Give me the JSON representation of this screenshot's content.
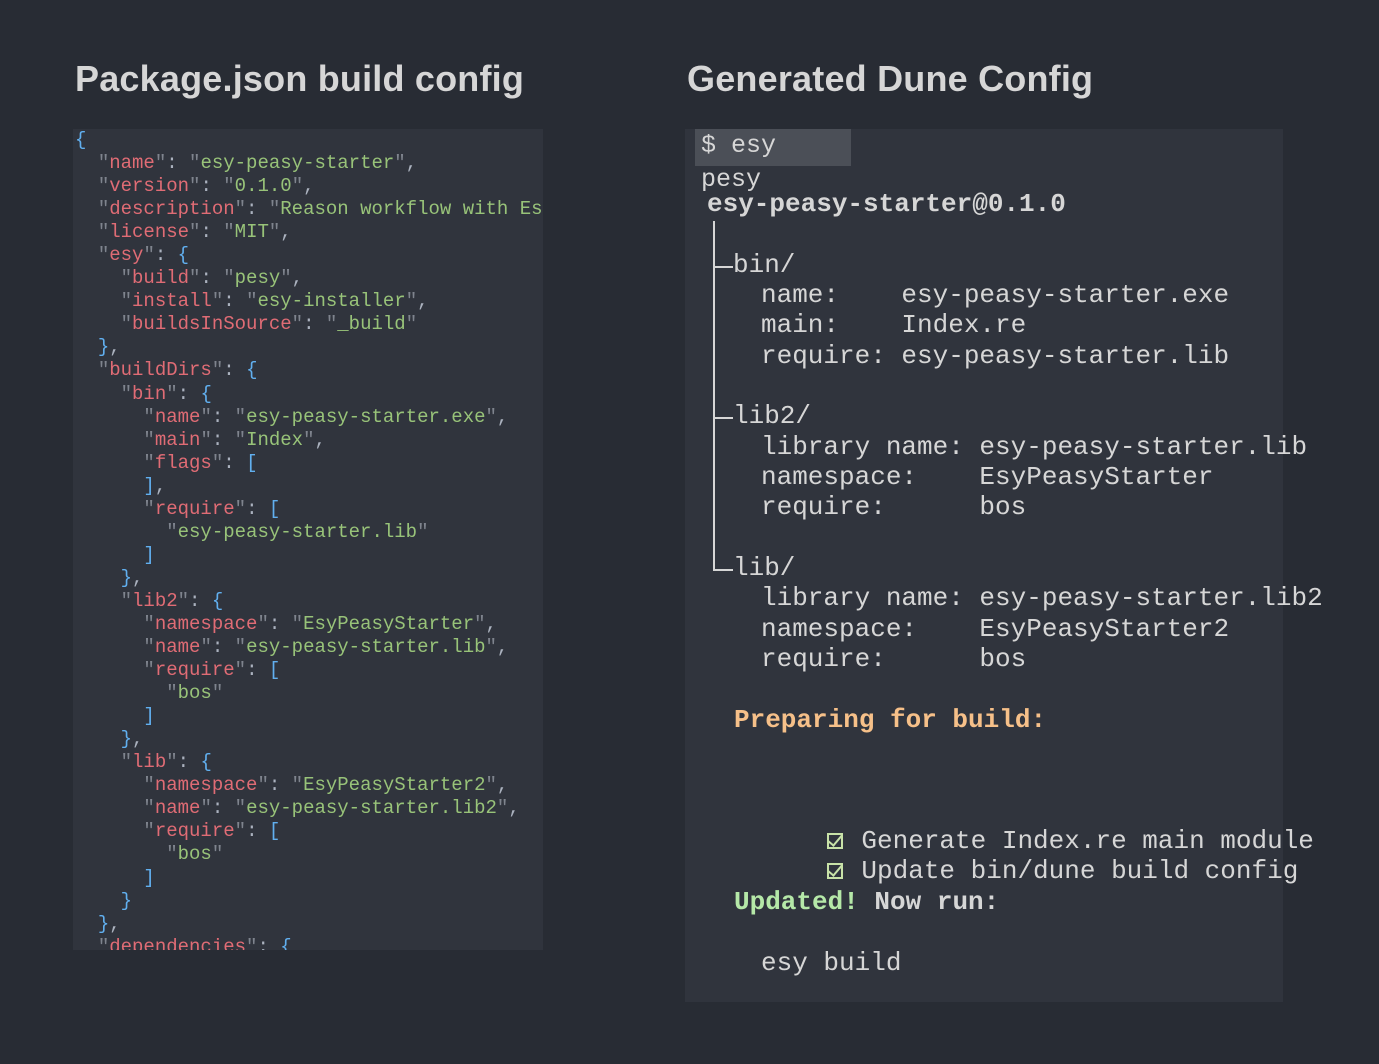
{
  "left_heading": "Package.json build config",
  "right_heading": "Generated Dune Config",
  "package_json": {
    "name_key": "name",
    "name_val": "esy-peasy-starter",
    "version_key": "version",
    "version_val": "0.1.0",
    "description_key": "description",
    "description_val": "Reason workflow with Esy",
    "license_key": "license",
    "license_val": "MIT",
    "esy_key": "esy",
    "build_key": "build",
    "build_val": "pesy",
    "install_key": "install",
    "install_val": "esy-installer",
    "bis_key": "buildsInSource",
    "bis_val": "_build",
    "builddirs_key": "buildDirs",
    "bin_key": "bin",
    "bin_name_key": "name",
    "bin_name_val": "esy-peasy-starter.exe",
    "bin_main_key": "main",
    "bin_main_val": "Index",
    "bin_flags_key": "flags",
    "bin_require_key": "require",
    "bin_require_val": "esy-peasy-starter.lib",
    "lib2_key": "lib2",
    "lib2_ns_key": "namespace",
    "lib2_ns_val": "EsyPeasyStarter",
    "lib2_name_key": "name",
    "lib2_name_val": "esy-peasy-starter.lib",
    "lib2_require_key": "require",
    "lib2_require_val": "bos",
    "lib_key": "lib",
    "lib_ns_key": "namespace",
    "lib_ns_val": "EsyPeasyStarter2",
    "lib_name_key": "name",
    "lib_name_val": "esy-peasy-starter.lib2",
    "lib_require_key": "require",
    "lib_require_val": "bos",
    "deps_key": "dependencies"
  },
  "terminal": {
    "command": "$ esy pesy",
    "package": "esy-peasy-starter@0.1.0",
    "bin_dir": "bin/",
    "bin_name": "name:    esy-peasy-starter.exe",
    "bin_main": "main:    Index.re",
    "bin_require": "require: esy-peasy-starter.lib",
    "lib2_dir": "lib2/",
    "lib2_name": "library name: esy-peasy-starter.lib",
    "lib2_ns": "namespace:    EsyPeasyStarter",
    "lib2_require": "require:      bos",
    "lib_dir": "lib/",
    "lib_name": "library name: esy-peasy-starter.lib2",
    "lib_ns": "namespace:    EsyPeasyStarter2",
    "lib_require": "require:      bos",
    "preparing": "Preparing for build:",
    "step1": "Generate Index.re main module",
    "step2": "Update bin/dune build config",
    "updated": "Updated!",
    "now_run": " Now run:",
    "final_cmd": "esy build"
  }
}
